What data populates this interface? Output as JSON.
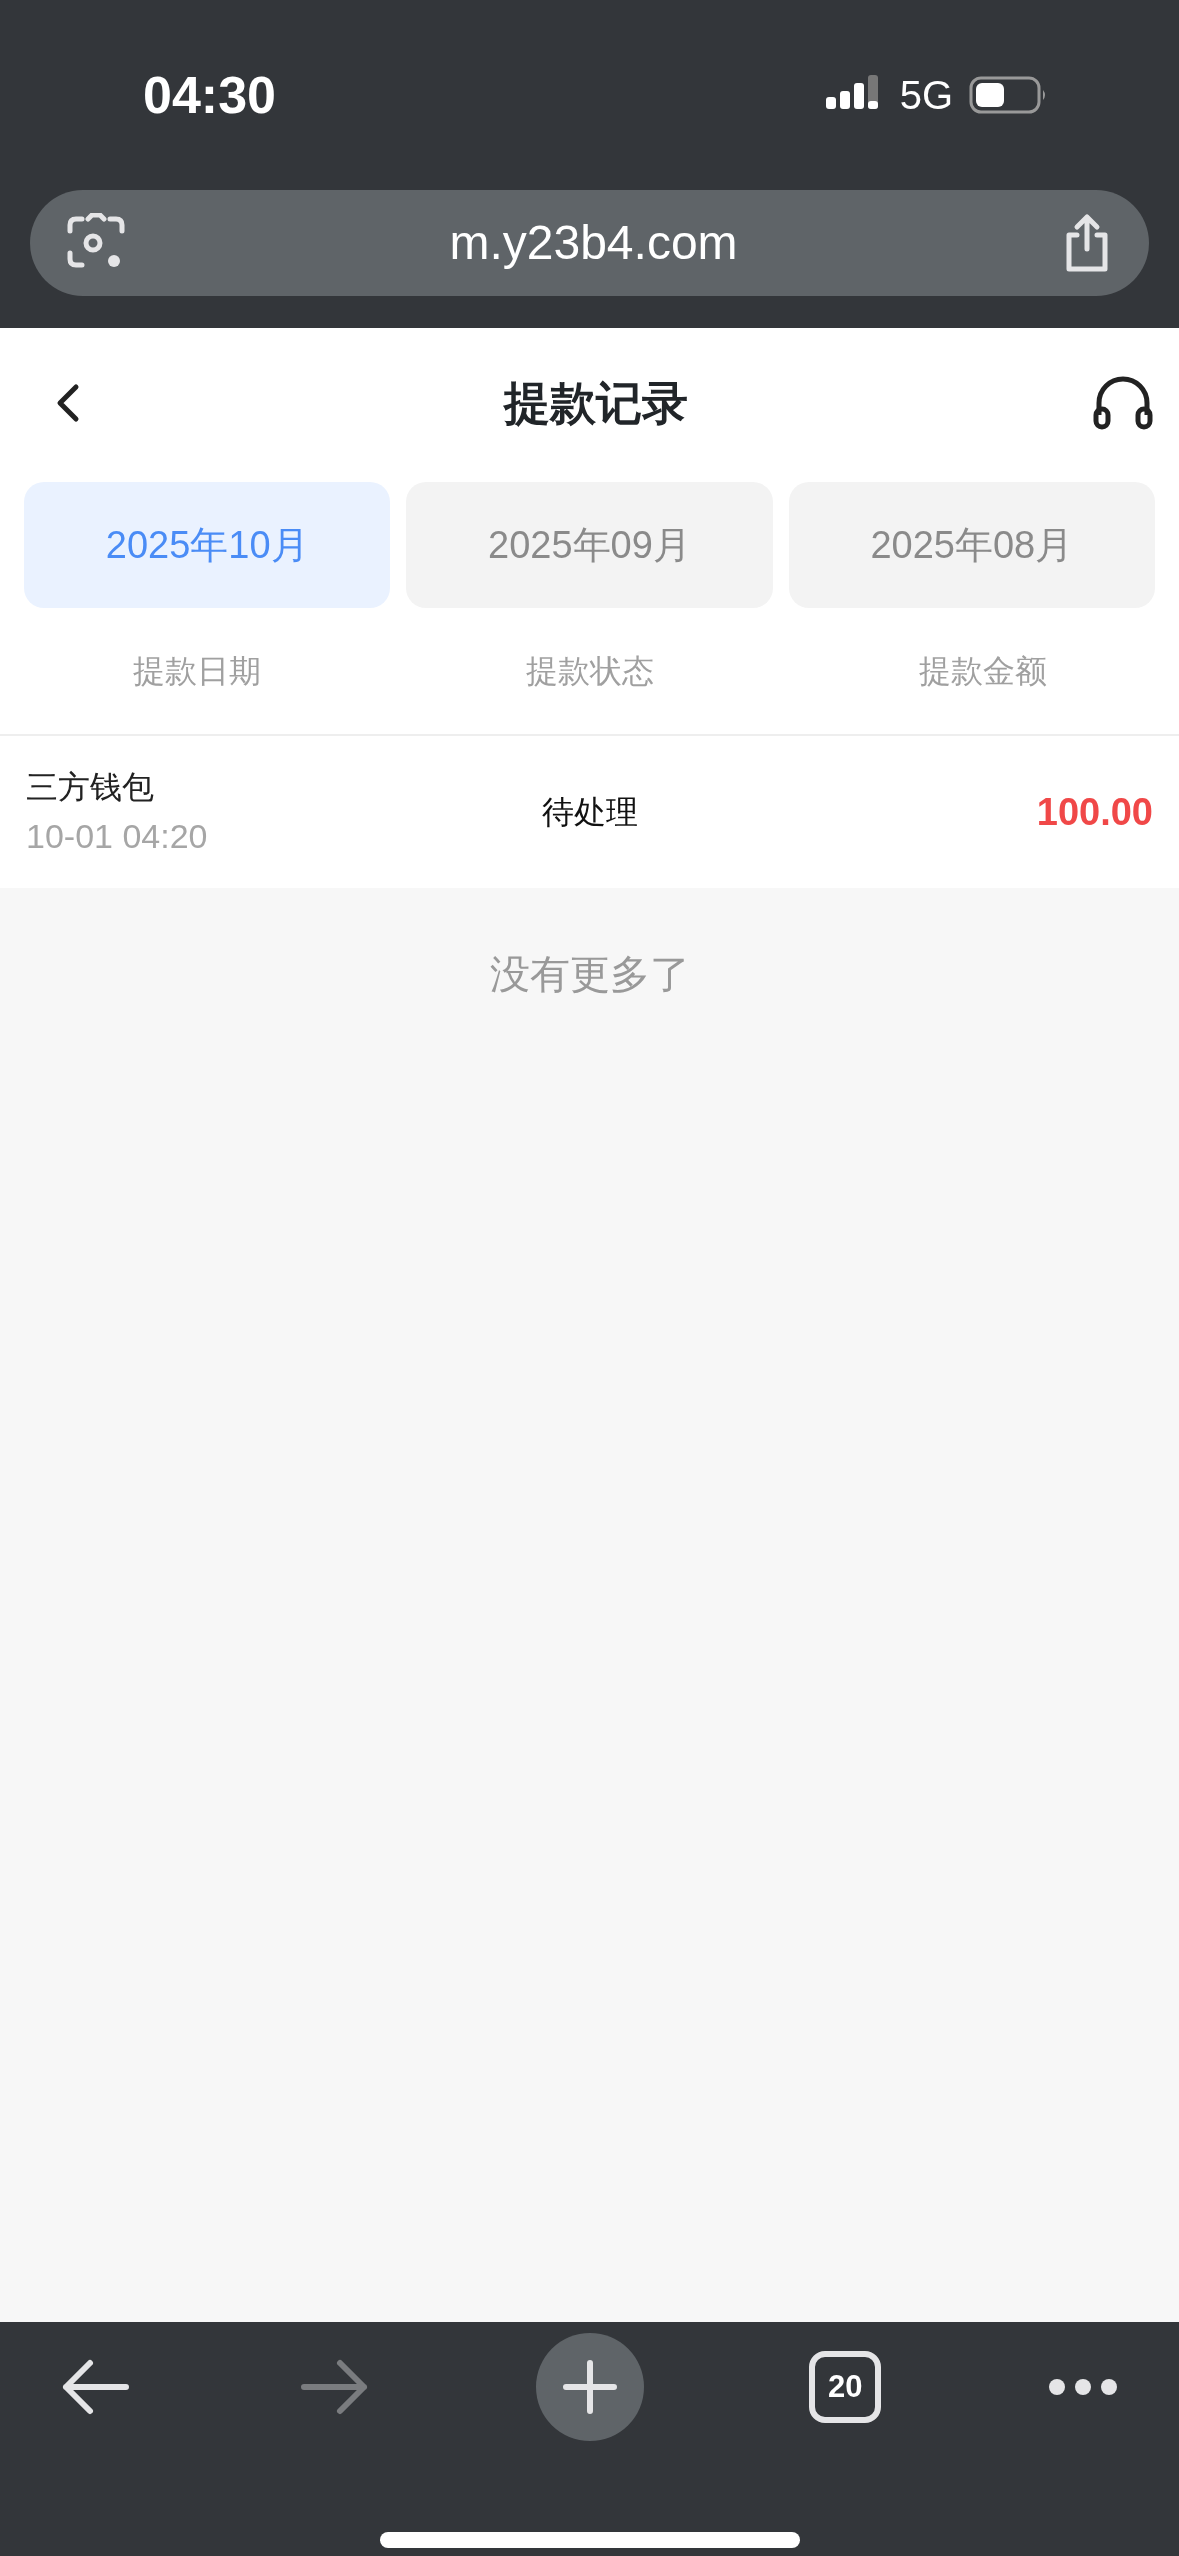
{
  "status_bar": {
    "time": "04:30",
    "network": "5G"
  },
  "browser": {
    "url": "m.y23b4.com",
    "tab_count": "20",
    "forward_disabled": true
  },
  "header": {
    "title": "提款记录"
  },
  "months": [
    {
      "label": "2025年10月",
      "selected": true
    },
    {
      "label": "2025年09月",
      "selected": false
    },
    {
      "label": "2025年08月",
      "selected": false
    }
  ],
  "columns": [
    "提款日期",
    "提款状态",
    "提款金额"
  ],
  "records": [
    {
      "method": "三方钱包",
      "time": "10-01 04:20",
      "status": "待处理",
      "amount": "100.00"
    }
  ],
  "end_text": "没有更多了"
}
